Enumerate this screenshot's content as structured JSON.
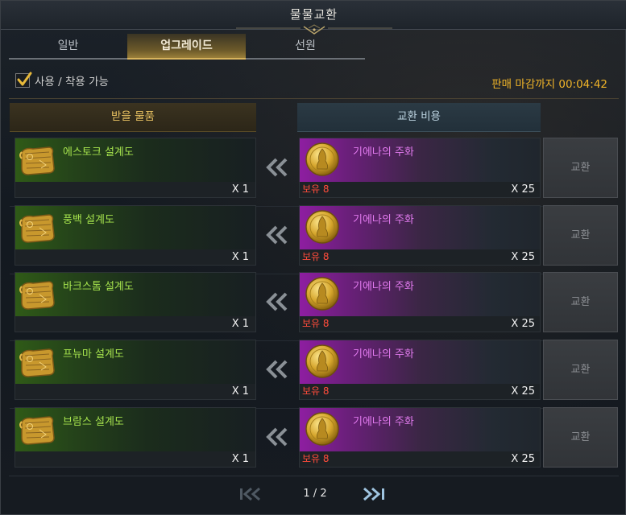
{
  "window": {
    "title": "물물교환"
  },
  "tabs": [
    {
      "label": "일반",
      "active": false
    },
    {
      "label": "업그레이드",
      "active": true
    },
    {
      "label": "선원",
      "active": false
    }
  ],
  "filter": {
    "label": "사용 / 착용 가능",
    "checked": true
  },
  "deadline": {
    "text": "판매 마감까지 00:04:42"
  },
  "columns": {
    "receive": "받을 물품",
    "cost": "교환 비용"
  },
  "rows": [
    {
      "item_name": "에스토크 설계도",
      "item_icon": "blueprint-scroll-icon",
      "item_qty": "X 1",
      "cost_name": "기에나의 주화",
      "cost_icon": "gold-coin-icon",
      "owned": "보유 8",
      "cost_qty": "X 25",
      "button": "교환"
    },
    {
      "item_name": "풍백 설계도",
      "item_icon": "blueprint-scroll-icon",
      "item_qty": "X 1",
      "cost_name": "기에나의 주화",
      "cost_icon": "gold-coin-icon",
      "owned": "보유 8",
      "cost_qty": "X 25",
      "button": "교환"
    },
    {
      "item_name": "바크스톰 설계도",
      "item_icon": "blueprint-scroll-icon",
      "item_qty": "X 1",
      "cost_name": "기에나의 주화",
      "cost_icon": "gold-coin-icon",
      "owned": "보유 8",
      "cost_qty": "X 25",
      "button": "교환"
    },
    {
      "item_name": "프뉴마 설계도",
      "item_icon": "blueprint-scroll-icon",
      "item_qty": "X 1",
      "cost_name": "기에나의 주화",
      "cost_icon": "gold-coin-icon",
      "owned": "보유 8",
      "cost_qty": "X 25",
      "button": "교환"
    },
    {
      "item_name": "브람스 설계도",
      "item_icon": "blueprint-scroll-icon",
      "item_qty": "X 1",
      "cost_name": "기에나의 주화",
      "cost_icon": "gold-coin-icon",
      "owned": "보유 8",
      "cost_qty": "X 25",
      "button": "교환"
    }
  ],
  "pagination": {
    "text": "1 / 2"
  },
  "colors": {
    "item_name": "#a6e34d",
    "cost_name": "#e27aef",
    "owned": "#ff4c3b",
    "deadline": "#f0b428",
    "tab_active_underline": "#d7b35d"
  }
}
